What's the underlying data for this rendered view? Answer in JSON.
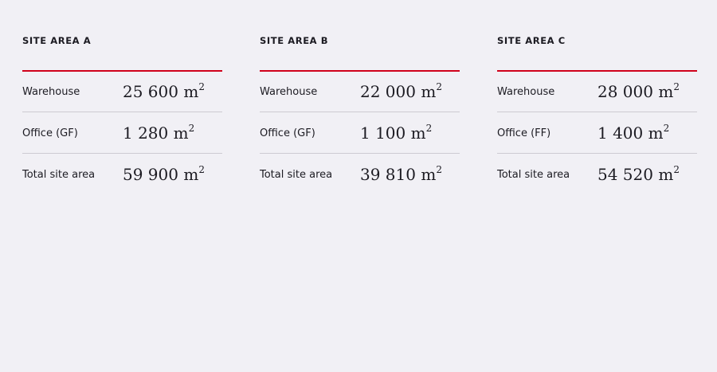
{
  "sites": [
    {
      "title": "SITE AREA A",
      "rows": [
        {
          "label": "Warehouse",
          "value": "25 600 m",
          "unit_exp": "2"
        },
        {
          "label": "Office (GF)",
          "value": "1 280 m",
          "unit_exp": "2"
        },
        {
          "label": "Total site area",
          "value": "59 900 m",
          "unit_exp": "2"
        }
      ]
    },
    {
      "title": "SITE AREA B",
      "rows": [
        {
          "label": "Warehouse",
          "value": "22 000 m",
          "unit_exp": "2"
        },
        {
          "label": "Office (GF)",
          "value": "1 100 m",
          "unit_exp": "2"
        },
        {
          "label": "Total site area",
          "value": "39 810 m",
          "unit_exp": "2"
        }
      ]
    },
    {
      "title": "SITE AREA C",
      "rows": [
        {
          "label": "Warehouse",
          "value": "28 000 m",
          "unit_exp": "2"
        },
        {
          "label": "Office (FF)",
          "value": "1 400 m",
          "unit_exp": "2"
        },
        {
          "label": "Total site area",
          "value": "54 520 m",
          "unit_exp": "2"
        }
      ]
    }
  ],
  "colors": {
    "background": "#f1f0f5",
    "accent_rule": "#d0021b",
    "divider": "#cdcbd2",
    "text": "#1c1b22"
  }
}
